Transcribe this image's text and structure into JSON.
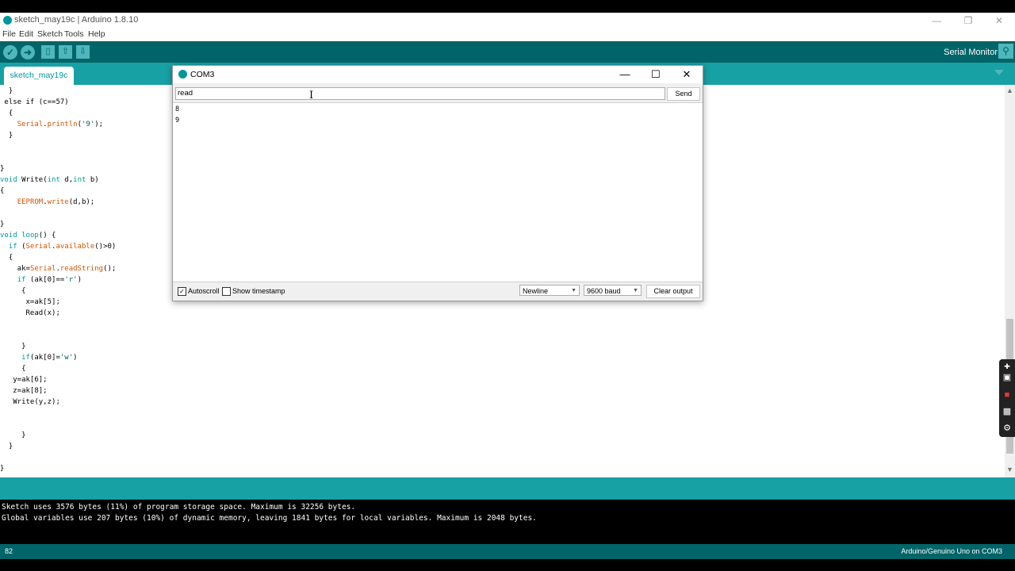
{
  "window": {
    "title": "sketch_may19c | Arduino 1.8.10"
  },
  "menu": [
    "File",
    "Edit",
    "Sketch",
    "Tools",
    "Help"
  ],
  "toolbar": {
    "serial_monitor_label": "Serial Monitor"
  },
  "tabs": {
    "active": "sketch_may19c"
  },
  "editor": {
    "lines": [
      "  }",
      " else if (c==57)",
      "  {",
      "    Serial.println('9');",
      "  }",
      "",
      "",
      "}",
      "void Write(int d,int b)",
      "{",
      "    EEPROM.write(d,b);",
      "",
      "}",
      "void loop() {",
      "  if (Serial.available()>0)",
      "  {",
      "    ak=Serial.readString();",
      "    if (ak[0]=='r')",
      "     {",
      "      x=ak[5];",
      "      Read(x);",
      "",
      "",
      "     }",
      "     if(ak[0]='w')",
      "     {",
      "   y=ak[6];",
      "   z=ak[8];",
      "   Write(y,z);",
      "",
      "",
      "     }",
      "  }",
      "",
      "}"
    ]
  },
  "console": {
    "lines": [
      "Sketch uses 3576 bytes (11%) of program storage space. Maximum is 32256 bytes.",
      "Global variables use 207 bytes (10%) of dynamic memory, leaving 1841 bytes for local variables. Maximum is 2048 bytes."
    ]
  },
  "status": {
    "line_number": "82",
    "board": "Arduino/Genuino Uno on COM3"
  },
  "serial_monitor": {
    "title": "COM3",
    "input_value": "read",
    "send_label": "Send",
    "output_lines": [
      "8",
      "9"
    ],
    "autoscroll_label": "Autoscroll",
    "autoscroll_checked": true,
    "timestamp_label": "Show timestamp",
    "timestamp_checked": false,
    "line_ending": "Newline",
    "baud": "9600 baud",
    "clear_label": "Clear output"
  },
  "colors": {
    "toolbar": "#006468",
    "tabbar": "#17a1a5",
    "accent": "#00979c"
  }
}
